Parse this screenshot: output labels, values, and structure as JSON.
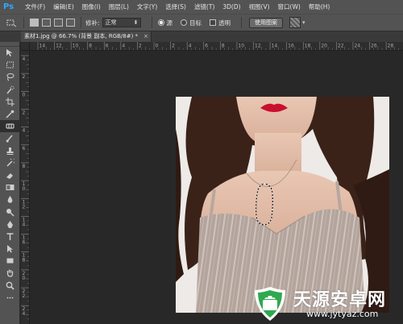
{
  "app": {
    "logo": "Ps"
  },
  "menu": {
    "items": [
      "文件(F)",
      "编辑(E)",
      "图像(I)",
      "图层(L)",
      "文字(Y)",
      "选择(S)",
      "滤镜(T)",
      "3D(D)",
      "视图(V)",
      "窗口(W)",
      "帮助(H)"
    ]
  },
  "options": {
    "tool_icon": "patch-tool-icon",
    "diffusion_label": "修补:",
    "diffusion_value": "正常",
    "source_label": "源",
    "target_label": "目标",
    "transparent_label": "透明",
    "use_pattern_label": "使用图案"
  },
  "document": {
    "tab_title": "素材1.jpg @ 66.7% (背景 副本, RGB/8#) *",
    "close_glyph": "×"
  },
  "ruler": {
    "top_labels": [
      "14",
      "12",
      "10",
      "8",
      "6",
      "4",
      "2",
      "0",
      "2",
      "4",
      "6",
      "8",
      "10",
      "12",
      "14",
      "16",
      "18",
      "20",
      "22",
      "24",
      "26",
      "28"
    ],
    "left_labels": [
      "4",
      "2",
      "0",
      "2",
      "4",
      "6",
      "8",
      "1\n0",
      "1\n2",
      "1\n4",
      "1\n6",
      "1\n8",
      "2\n0",
      "2\n2",
      "2\n4"
    ]
  },
  "watermark": {
    "title": "天源安卓网",
    "url": "www.jytyaz.com"
  },
  "colors": {
    "ui_panel": "#535353",
    "canvas_bg": "#282828",
    "ps_blue": "#31a8ff",
    "watermark_green": "#2fa84f"
  }
}
